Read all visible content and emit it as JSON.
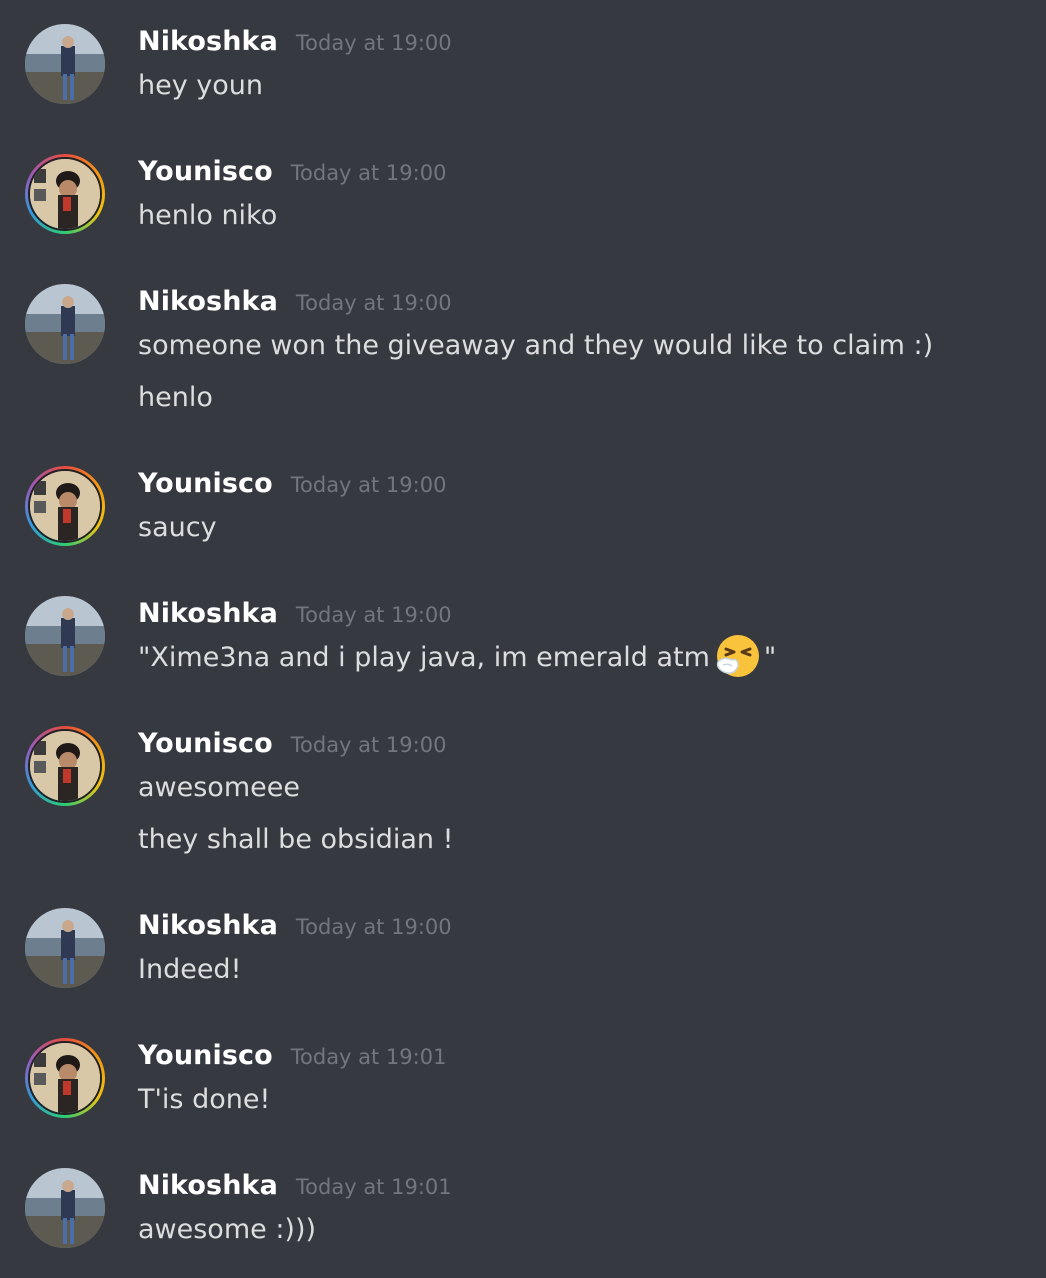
{
  "users": {
    "nikoshka": "Nikoshka",
    "younisco": "Younisco"
  },
  "messages": [
    {
      "author": "Nikoshka",
      "time": "Today at 19:00",
      "lines": [
        "hey youn"
      ]
    },
    {
      "author": "Younisco",
      "time": "Today at 19:00",
      "lines": [
        "henlo niko"
      ]
    },
    {
      "author": "Nikoshka",
      "time": "Today at 19:00",
      "lines": [
        "someone won the giveaway and they would like to claim :)",
        "henlo"
      ]
    },
    {
      "author": "Younisco",
      "time": "Today at 19:00",
      "lines": [
        "saucy"
      ]
    },
    {
      "author": "Nikoshka",
      "time": "Today at 19:00",
      "lines": [
        "\"Xime3na and i play java, im emerald atm",
        "\""
      ],
      "emoji": "sneezing-face-emoji"
    },
    {
      "author": "Younisco",
      "time": "Today at 19:00",
      "lines": [
        "awesomeee",
        "they shall be obsidian !"
      ]
    },
    {
      "author": "Nikoshka",
      "time": "Today at 19:00",
      "lines": [
        "Indeed!"
      ]
    },
    {
      "author": "Younisco",
      "time": "Today at 19:01",
      "lines": [
        "T'is done!"
      ]
    },
    {
      "author": "Nikoshka",
      "time": "Today at 19:01",
      "lines": [
        "awesome :)))"
      ]
    }
  ],
  "colors": {
    "background": "#36393f",
    "username": "#ffffff",
    "timestamp": "#72767d",
    "text": "#dcddde"
  }
}
